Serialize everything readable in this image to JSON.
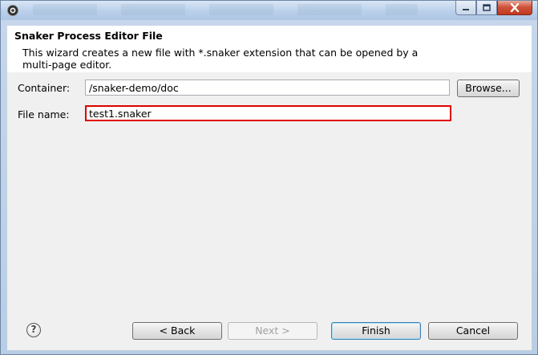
{
  "dialog": {
    "title": "Snaker Process Editor File",
    "description": "This wizard creates a new file with *.snaker extension that can be opened by a multi-page editor."
  },
  "form": {
    "container_label": "Container:",
    "container_value": "/snaker-demo/doc",
    "browse_label": "Browse...",
    "filename_label": "File name:",
    "filename_value": "test1.snaker"
  },
  "buttons": {
    "back": "< Back",
    "next": "Next >",
    "finish": "Finish",
    "cancel": "Cancel"
  },
  "help_icon": "?",
  "icons": [
    "app-icon",
    "minimize-icon",
    "maximize-icon",
    "close-icon",
    "help-icon"
  ],
  "colors": {
    "highlight": "#e00000",
    "close_button": "#c2391f"
  }
}
